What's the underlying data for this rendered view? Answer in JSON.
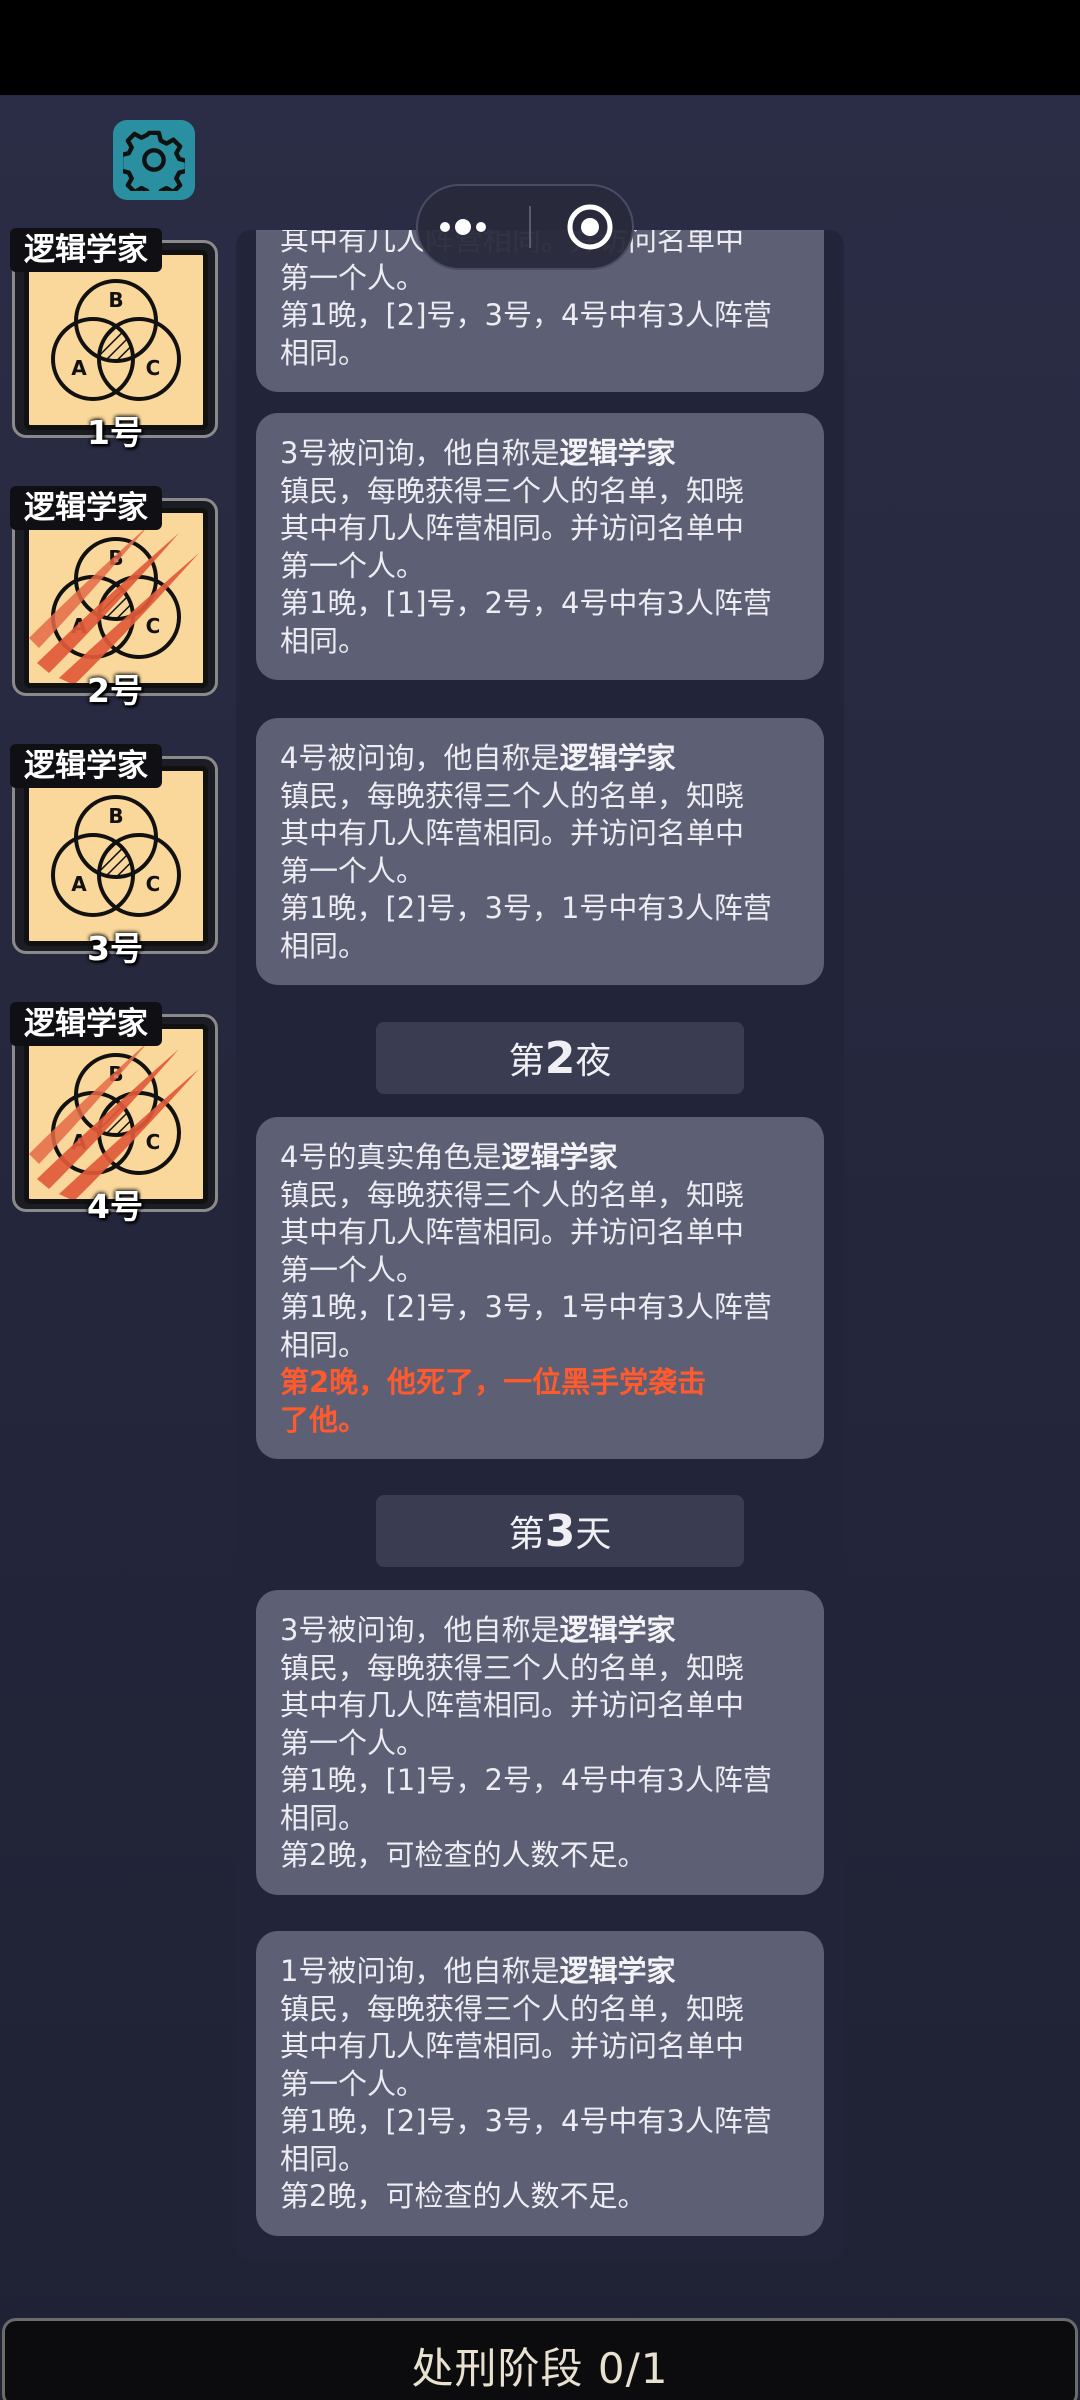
{
  "colors": {
    "accent_red": "#ff5a2e",
    "settings_teal": "#2a8fa0",
    "token_bg": "#fad79a"
  },
  "toolbar": {
    "settings_icon": "gear-icon",
    "menu_icon": "more-dots-icon",
    "close_icon": "target-icon"
  },
  "players": [
    {
      "role": "逻辑学家",
      "seat": "1号",
      "dead": false
    },
    {
      "role": "逻辑学家",
      "seat": "2号",
      "dead": true
    },
    {
      "role": "逻辑学家",
      "seat": "3号",
      "dead": false
    },
    {
      "role": "逻辑学家",
      "seat": "4号",
      "dead": true
    }
  ],
  "venn_labels": {
    "a": "A",
    "b": "B",
    "c": "C"
  },
  "log": {
    "card0": {
      "lines": [
        "其中有几人阵营相同。并访问名单中",
        "第一个人。",
        "第1晚，[2]号，3号，4号中有3人阵营",
        "相同。"
      ]
    },
    "card1": {
      "head": "3号被问询，他自称是",
      "role": "逻辑学家",
      "lines": [
        "镇民，每晚获得三个人的名单，知晓",
        "其中有几人阵营相同。并访问名单中",
        "第一个人。",
        "第1晚，[1]号，2号，4号中有3人阵营",
        "相同。"
      ]
    },
    "card2": {
      "head": "4号被问询，他自称是",
      "role": "逻辑学家",
      "lines": [
        "镇民，每晚获得三个人的名单，知晓",
        "其中有几人阵营相同。并访问名单中",
        "第一个人。",
        "第1晚，[2]号，3号，1号中有3人阵营",
        "相同。"
      ]
    },
    "phase1": {
      "pre": "第",
      "num": "2",
      "post": "夜"
    },
    "card3": {
      "head": "4号的真实角色是",
      "role": "逻辑学家",
      "lines": [
        "镇民，每晚获得三个人的名单，知晓",
        "其中有几人阵营相同。并访问名单中",
        "第一个人。",
        "第1晚，[2]号，3号，1号中有3人阵营",
        "相同。"
      ],
      "death1": "第2晚，他死了，一位黑手党袭击",
      "death2": "了他。"
    },
    "phase2": {
      "pre": "第",
      "num": "3",
      "post": "天"
    },
    "card4": {
      "head": "3号被问询，他自称是",
      "role": "逻辑学家",
      "lines": [
        "镇民，每晚获得三个人的名单，知晓",
        "其中有几人阵营相同。并访问名单中",
        "第一个人。",
        "第1晚，[1]号，2号，4号中有3人阵营",
        "相同。",
        "第2晚，可检查的人数不足。"
      ]
    },
    "card5": {
      "head": "1号被问询，他自称是",
      "role": "逻辑学家",
      "lines": [
        "镇民，每晚获得三个人的名单，知晓",
        "其中有几人阵营相同。并访问名单中",
        "第一个人。",
        "第1晚，[2]号，3号，4号中有3人阵营",
        "相同。",
        "第2晚，可检查的人数不足。"
      ]
    }
  },
  "bottom_bar": {
    "label": "处刑阶段 0/1"
  }
}
